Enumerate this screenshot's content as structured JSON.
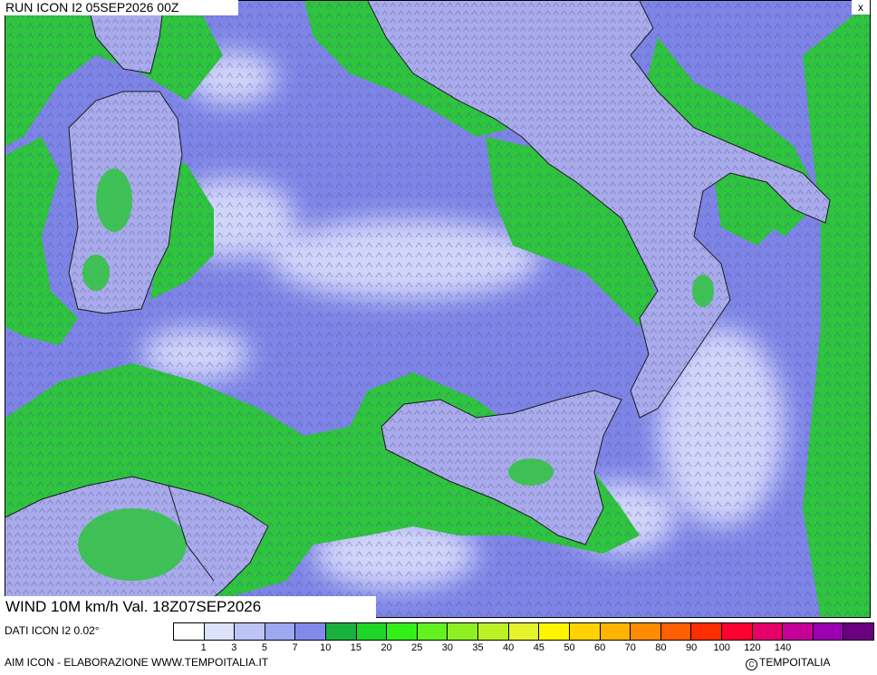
{
  "header": {
    "run_label": "RUN ICON I2 05SEP2026 00Z",
    "close_glyph": "x"
  },
  "map": {
    "valid_label": "WIND 10M km/h Val. 18Z07SEP2026",
    "sea_color": "#7d84e6",
    "land_color": "#a9abec",
    "calm_color": "#eef0ff",
    "breeze_color": "#2ec43e",
    "border_color": "#1a1a1a"
  },
  "footer": {
    "data_label": "DATI ICON I2 0.02°",
    "credit": "AIM ICON - ELABORAZIONE WWW.TEMPOITALIA.IT",
    "brand": "TEMPOITALIA",
    "copyright_glyph": "C"
  },
  "legend": {
    "colors": [
      "#ffffff",
      "#dde2fb",
      "#bcc4f5",
      "#9ea8f0",
      "#818aea",
      "#19b23c",
      "#1fd628",
      "#33f018",
      "#62f222",
      "#8ef022",
      "#bcf225",
      "#e6f22a",
      "#fff500",
      "#ffd200",
      "#ffb400",
      "#ff8c00",
      "#ff5f00",
      "#ff2e00",
      "#ff0032",
      "#e6006a",
      "#c40098",
      "#9a00b0",
      "#6a0080"
    ],
    "ticks": [
      "1",
      "3",
      "5",
      "7",
      "10",
      "15",
      "20",
      "25",
      "30",
      "35",
      "40",
      "45",
      "50",
      "60",
      "70",
      "80",
      "90",
      "100",
      "120",
      "140"
    ]
  }
}
